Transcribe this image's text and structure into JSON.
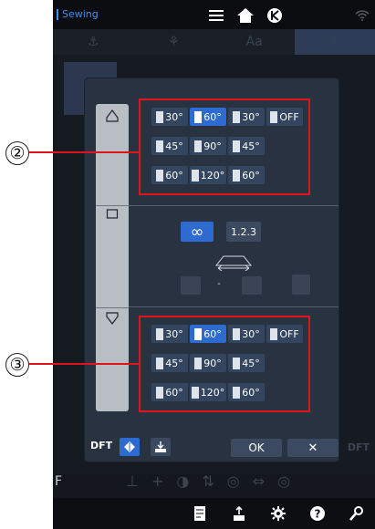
{
  "app": {
    "mode_label": "Sewing"
  },
  "background": {
    "tab_text": "Aa",
    "dft_label": "DFT",
    "f_label": "F"
  },
  "callouts": [
    "②",
    "③"
  ],
  "top_section": {
    "rows": [
      [
        {
          "label": "30°",
          "selected": false
        },
        {
          "label": "60°",
          "selected": true
        },
        {
          "label": "30°",
          "selected": false
        },
        {
          "label": "OFF",
          "selected": false
        }
      ],
      [
        {
          "label": "45°",
          "selected": false
        },
        {
          "label": "90°",
          "selected": false
        },
        {
          "label": "45°",
          "selected": false
        }
      ],
      [
        {
          "label": "60°",
          "selected": false
        },
        {
          "label": "120°",
          "selected": false
        },
        {
          "label": "60°",
          "selected": false
        }
      ]
    ]
  },
  "middle_section": {
    "infinity_label": "∞",
    "repeat_label": "1.2.3",
    "dash_label": "-"
  },
  "bottom_section": {
    "rows": [
      [
        {
          "label": "30°",
          "selected": false
        },
        {
          "label": "60°",
          "selected": true
        },
        {
          "label": "30°",
          "selected": false
        },
        {
          "label": "OFF",
          "selected": false
        }
      ],
      [
        {
          "label": "45°",
          "selected": false
        },
        {
          "label": "90°",
          "selected": false
        },
        {
          "label": "45°",
          "selected": false
        }
      ],
      [
        {
          "label": "60°",
          "selected": false
        },
        {
          "label": "120°",
          "selected": false
        },
        {
          "label": "60°",
          "selected": false
        }
      ]
    ]
  },
  "footer": {
    "dft_label": "DFT",
    "ok_label": "OK",
    "cancel_label": "✕"
  },
  "colors": {
    "accent": "#2d6bd0",
    "callout_red": "#e0141c",
    "dialog_bg": "#293240"
  }
}
